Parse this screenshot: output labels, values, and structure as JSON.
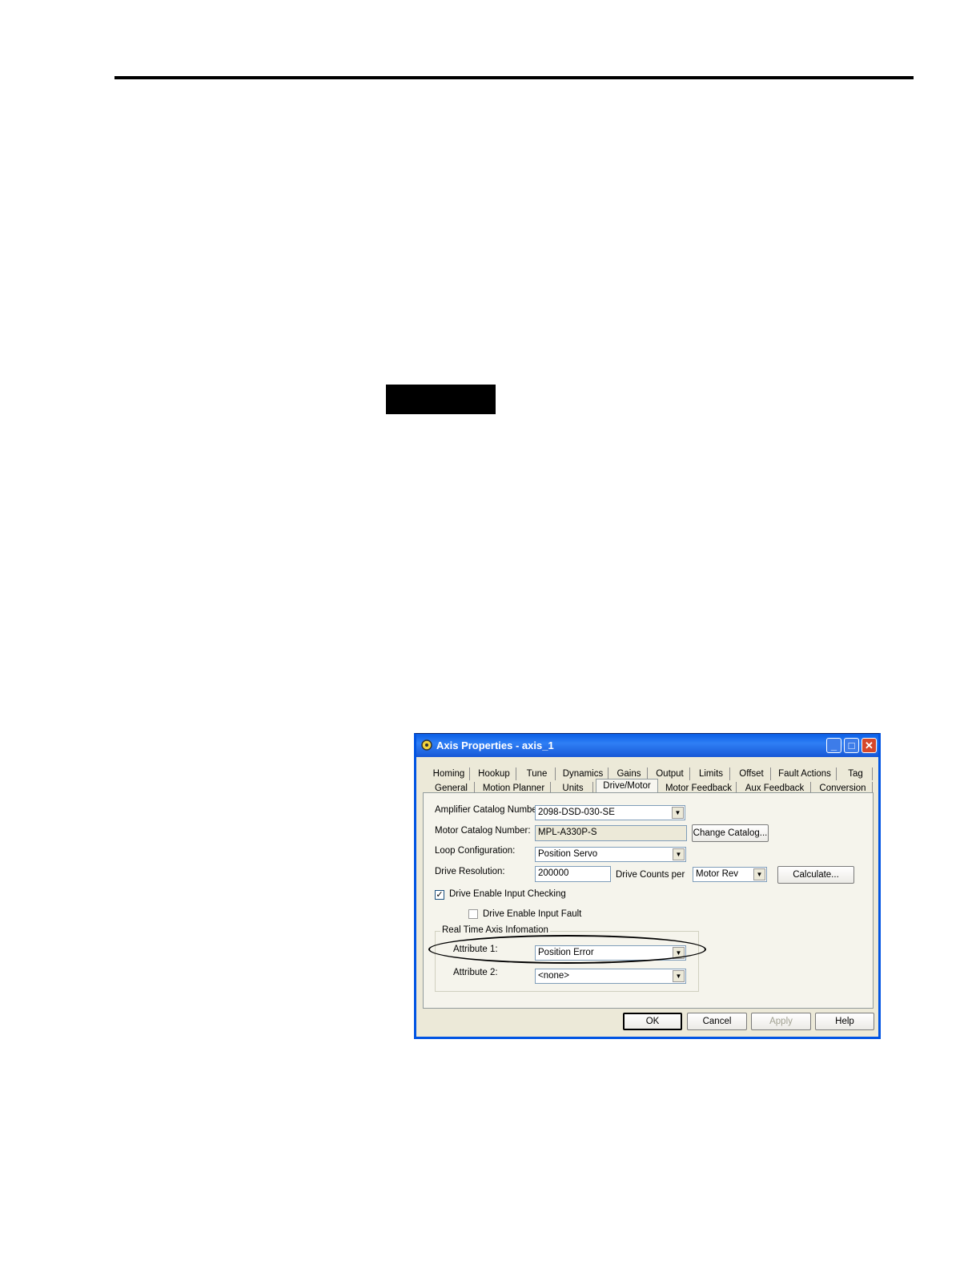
{
  "dialog": {
    "title": "Axis Properties - axis_1",
    "tabs_row1": [
      "Homing",
      "Hookup",
      "Tune",
      "Dynamics",
      "Gains",
      "Output",
      "Limits",
      "Offset",
      "Fault Actions",
      "Tag"
    ],
    "tabs_row2": [
      "General",
      "Motion Planner",
      "Units",
      "Drive/Motor",
      "Motor Feedback",
      "Aux Feedback",
      "Conversion"
    ],
    "active_tab": "Drive/Motor",
    "amplifier_label": "Amplifier Catalog Number:",
    "amplifier_value": "2098-DSD-030-SE",
    "motor_label": "Motor Catalog Number:",
    "motor_value": "MPL-A330P-S",
    "change_catalog_label": "Change Catalog...",
    "loop_label": "Loop Configuration:",
    "loop_value": "Position Servo",
    "resolution_label": "Drive Resolution:",
    "resolution_value": "200000",
    "counts_per_label": "Drive Counts per",
    "counts_per_value": "Motor Rev",
    "calculate_label": "Calculate...",
    "enable_check_label": "Drive Enable Input Checking",
    "enable_check_checked": true,
    "enable_fault_label": "Drive Enable Input Fault",
    "enable_fault_checked": false,
    "group_label": "Real Time Axis Infomation",
    "attr1_label": "Attribute 1:",
    "attr1_value": "Position Error",
    "attr2_label": "Attribute 2:",
    "attr2_value": "<none>",
    "ok_label": "OK",
    "cancel_label": "Cancel",
    "apply_label": "Apply",
    "help_label": "Help",
    "check_glyph": "✓",
    "arrow_glyph": "▼",
    "min_glyph": "_",
    "max_glyph": "□",
    "close_glyph": "✕"
  }
}
